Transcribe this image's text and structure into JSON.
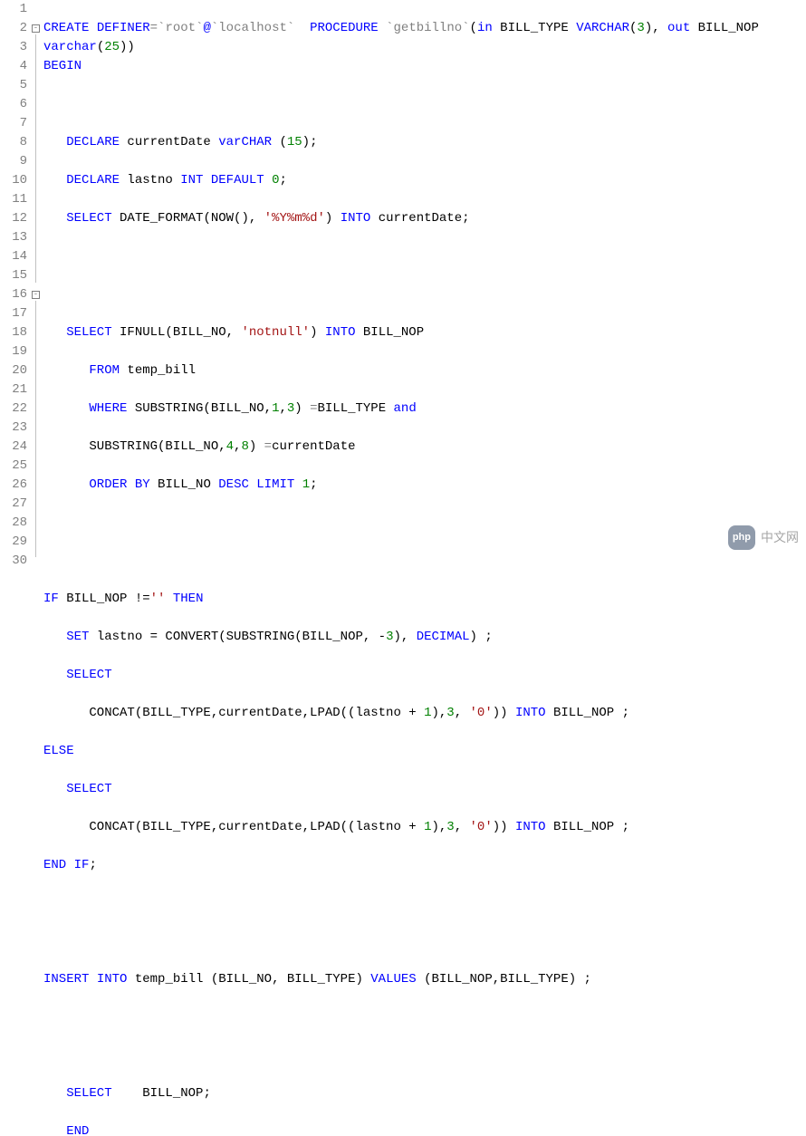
{
  "line_numbers": [
    "1",
    "2",
    "3",
    "4",
    "5",
    "6",
    "7",
    "8",
    "9",
    "10",
    "11",
    "12",
    "13",
    "14",
    "15",
    "16",
    "17",
    "18",
    "19",
    "20",
    "21",
    "22",
    "23",
    "24",
    "25",
    "26",
    "27",
    "28",
    "29",
    "30"
  ],
  "watermark": {
    "logo": "php",
    "text": "中文网"
  },
  "code": {
    "l1": {
      "a": "CREATE",
      "b": " DEFINER",
      "c": "=",
      "d": "`root`",
      "e": "@",
      "f": "`localhost`",
      "g": "  PROCEDURE ",
      "h": "`getbillno`",
      "i": "(",
      "j": "in",
      "k": " BILL_TYPE ",
      "l": "VARCHAR",
      "m": "(",
      "n": "3",
      "o": "), ",
      "p": "out",
      "q": " BILL_NOP"
    },
    "l1b": {
      "a": "varchar",
      "b": "(",
      "c": "25",
      "d": "))"
    },
    "l2": {
      "a": "BEGIN"
    },
    "l4": {
      "a": "   DECLARE",
      "b": " currentDate ",
      "c": "varCHAR",
      "d": " (",
      "e": "15",
      "f": ");"
    },
    "l5": {
      "a": "   DECLARE",
      "b": " lastno ",
      "c": "INT",
      "d": " ",
      "e": "DEFAULT",
      "f": " ",
      "g": "0",
      "h": ";"
    },
    "l6": {
      "a": "   SELECT",
      "b": " DATE_FORMAT(NOW(), ",
      "c": "'%Y%m%d'",
      "d": ") ",
      "e": "INTO",
      "f": " currentDate;"
    },
    "l9": {
      "a": "   SELECT",
      "b": " IFNULL(BILL_NO, ",
      "c": "'notnull'",
      "d": ") ",
      "e": "INTO",
      "f": " BILL_NOP"
    },
    "l10": {
      "a": "      FROM",
      "b": " temp_bill"
    },
    "l11": {
      "a": "      WHERE",
      "b": " SUBSTRING(BILL_NO,",
      "c": "1",
      "d": ",",
      "e": "3",
      "f": ") ",
      "g": "=",
      "h": "BILL_TYPE ",
      "i": "and"
    },
    "l12": {
      "a": "      SUBSTRING(BILL_NO,",
      "b": "4",
      "c": ",",
      "d": "8",
      "e": ") ",
      "f": "=",
      "g": "currentDate"
    },
    "l13": {
      "a": "      ORDER",
      "b": " ",
      "c": "BY",
      "d": " BILL_NO ",
      "e": "DESC",
      "f": " ",
      "g": "LIMIT",
      "h": " ",
      "i": "1",
      "j": ";"
    },
    "l16": {
      "a": "IF",
      "b": " BILL_NOP !=",
      "c": "''",
      "d": " ",
      "e": "THEN"
    },
    "l17": {
      "a": "   SET",
      "b": " lastno = CONVERT(SUBSTRING(BILL_NOP, -",
      "c": "3",
      "d": "), ",
      "e": "DECIMAL",
      "f": ") ;"
    },
    "l18": {
      "a": "   SELECT"
    },
    "l19": {
      "a": "      CONCAT(BILL_TYPE,currentDate,LPAD((lastno + ",
      "b": "1",
      "c": "),",
      "d": "3",
      "e": ", ",
      "f": "'0'",
      "g": ")) ",
      "h": "INTO",
      "i": " BILL_NOP ;"
    },
    "l20": {
      "a": "ELSE"
    },
    "l21": {
      "a": "   SELECT"
    },
    "l22": {
      "a": "      CONCAT(BILL_TYPE,currentDate,LPAD((lastno + ",
      "b": "1",
      "c": "),",
      "d": "3",
      "e": ", ",
      "f": "'0'",
      "g": ")) ",
      "h": "INTO",
      "i": " BILL_NOP ;"
    },
    "l23": {
      "a": "END",
      "b": " ",
      "c": "IF",
      "d": ";"
    },
    "l26": {
      "a": "INSERT",
      "b": " ",
      "c": "INTO",
      "d": " temp_bill (BILL_NO, BILL_TYPE) ",
      "e": "VALUES",
      "f": " (BILL_NOP,BILL_TYPE) ;"
    },
    "l29": {
      "a": "   SELECT",
      "b": "    BILL_NOP;"
    },
    "l30": {
      "a": "   END"
    }
  }
}
